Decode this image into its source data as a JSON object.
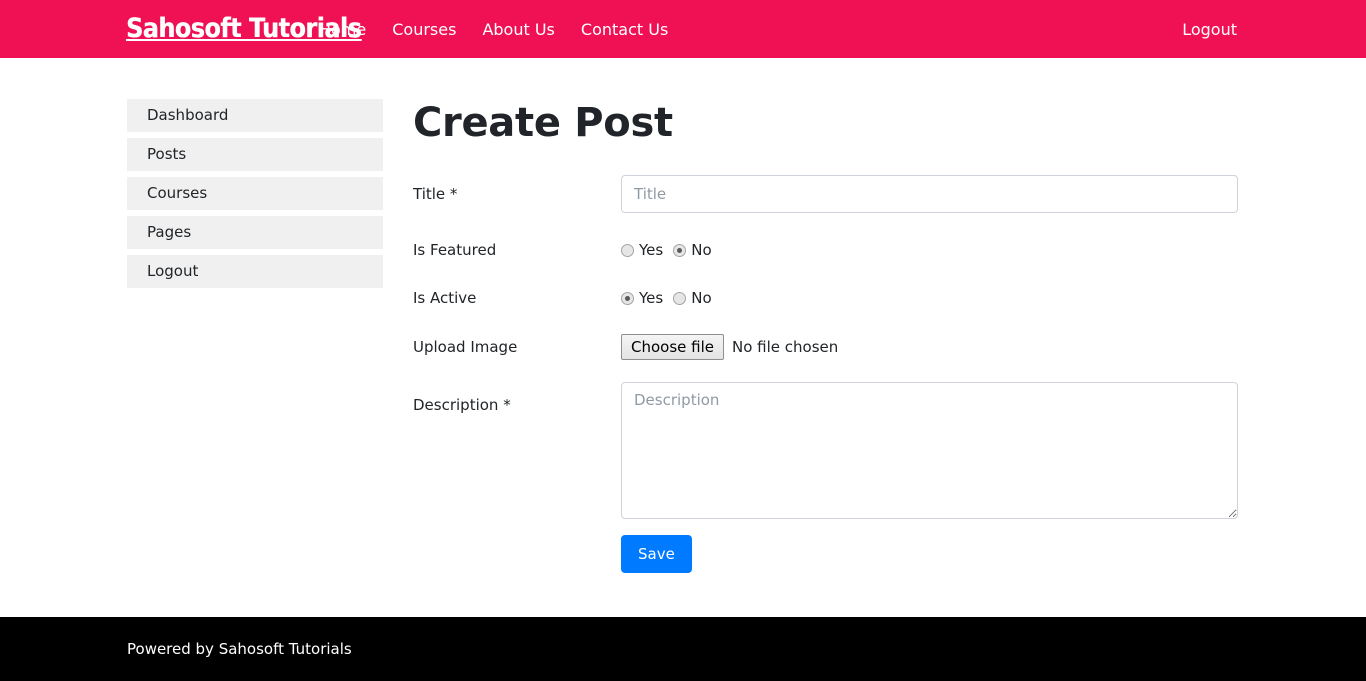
{
  "header": {
    "brand": "Sahosoft Tutorials",
    "nav_items": [
      {
        "label": "Home"
      },
      {
        "label": "Courses"
      },
      {
        "label": "About Us"
      },
      {
        "label": "Contact Us"
      }
    ],
    "logout_label": "Logout",
    "background_color": "#ef1153"
  },
  "sidebar": {
    "items": [
      {
        "label": "Dashboard"
      },
      {
        "label": "Posts"
      },
      {
        "label": "Courses"
      },
      {
        "label": "Pages"
      },
      {
        "label": "Logout"
      }
    ]
  },
  "main": {
    "page_title": "Create Post",
    "fields": {
      "title": {
        "label": "Title *",
        "value": "",
        "placeholder": "Title"
      },
      "is_featured": {
        "label": "Is Featured",
        "options": [
          {
            "label": "Yes",
            "checked": false
          },
          {
            "label": "No",
            "checked": true
          }
        ]
      },
      "is_active": {
        "label": "Is Active",
        "options": [
          {
            "label": "Yes",
            "checked": true
          },
          {
            "label": "No",
            "checked": false
          }
        ]
      },
      "upload_image": {
        "label": "Upload Image",
        "button_label": "Choose file",
        "status_text": "No file chosen"
      },
      "description": {
        "label": "Description *",
        "value": "",
        "placeholder": "Description"
      }
    },
    "save_label": "Save",
    "save_color": "#007bff"
  },
  "footer": {
    "text": "Powered by Sahosoft Tutorials",
    "background_color": "#000000"
  }
}
